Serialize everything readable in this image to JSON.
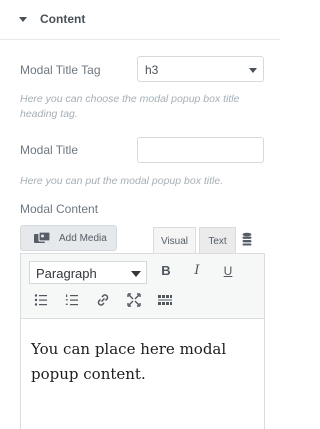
{
  "section": {
    "title": "Content"
  },
  "fields": {
    "modal_title_tag": {
      "label": "Modal Title Tag",
      "value": "h3",
      "description": "Here you can choose the modal popup box title heading tag."
    },
    "modal_title": {
      "label": "Modal Title",
      "value": "",
      "description": "Here you can put the modal popup box title."
    },
    "modal_content": {
      "label": "Modal Content"
    }
  },
  "editor": {
    "add_media_label": "Add Media",
    "tabs": {
      "visual": "Visual",
      "text": "Text"
    },
    "format_value": "Paragraph",
    "bold_label": "B",
    "italic_label": "I",
    "underline_label": "U",
    "content": "You can place here modal popup content."
  },
  "icons": {
    "section_toggle": "caret-down-icon",
    "add_media": "media-icon",
    "toolbar_toggle": "database-icon",
    "bullet_list": "bullet-list-icon",
    "numbered_list": "numbered-list-icon",
    "link": "link-icon",
    "fullscreen": "fullscreen-icon",
    "kitchen_sink": "toolbar-toggle-icon"
  },
  "colors": {
    "accent": "#495157",
    "border": "#d5dadf",
    "muted": "#a4afb7"
  }
}
